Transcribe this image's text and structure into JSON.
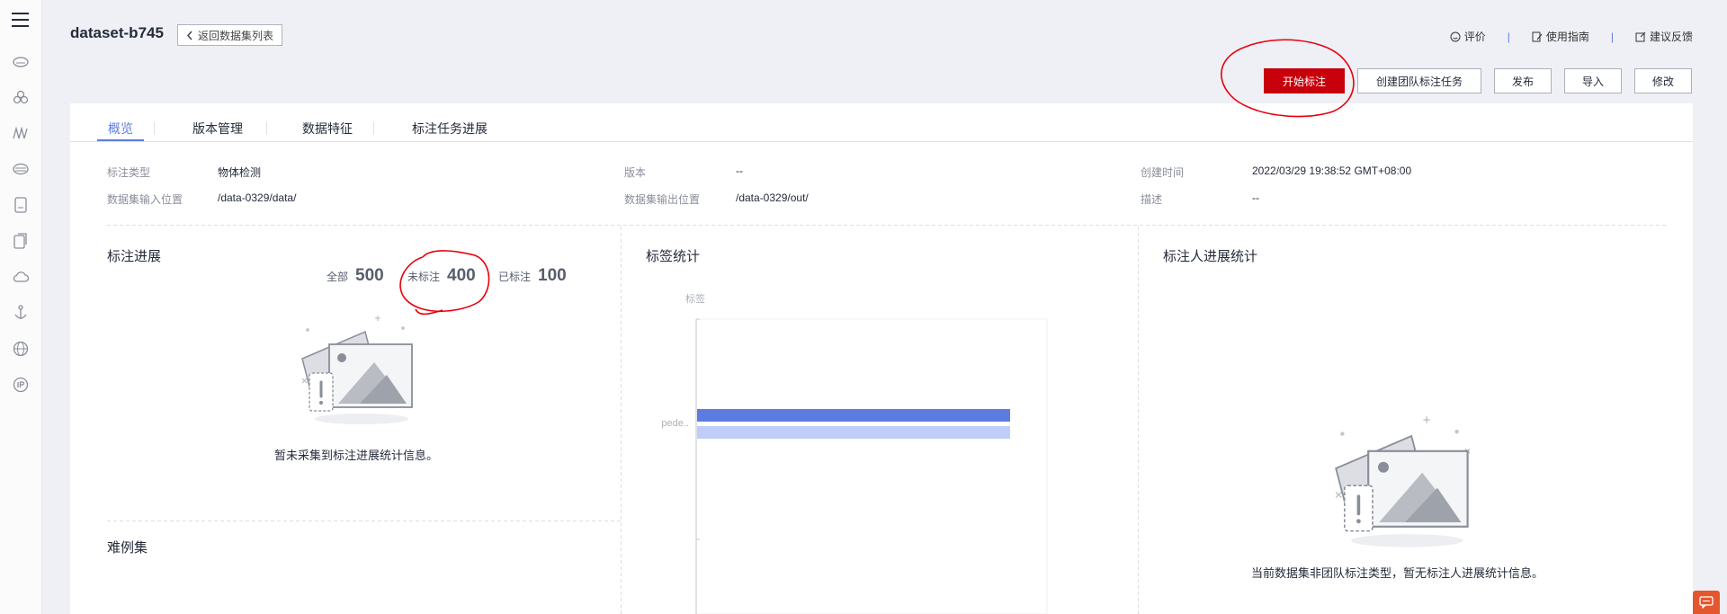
{
  "header": {
    "dataset_title": "dataset-b745",
    "back_label": "返回数据集列表",
    "links": {
      "rate": "评价",
      "guide": "使用指南",
      "feedback": "建议反馈"
    }
  },
  "actions": {
    "start_label": "开始标注",
    "team_label": "创建团队标注任务",
    "publish_label": "发布",
    "import_label": "导入",
    "edit_label": "修改"
  },
  "tabs": [
    "概览",
    "版本管理",
    "数据特征",
    "标注任务进展"
  ],
  "meta": {
    "label_type_key": "标注类型",
    "label_type_val": "物体检测",
    "input_key": "数据集输入位置",
    "input_val": "/data-0329/data/",
    "version_key": "版本",
    "version_val": "--",
    "output_key": "数据集输出位置",
    "output_val": "/data-0329/out/",
    "created_key": "创建时间",
    "created_val": "2022/03/29 19:38:52 GMT+08:00",
    "desc_key": "描述",
    "desc_val": "--"
  },
  "progress": {
    "title": "标注进展",
    "all_label": "全部",
    "all_value": "500",
    "unlabeled_label": "未标注",
    "unlabeled_value": "400",
    "labeled_label": "已标注",
    "labeled_value": "100",
    "empty_text": "暂未采集到标注进展统计信息。"
  },
  "hard_examples": {
    "title": "难例集"
  },
  "label_stats": {
    "title": "标签统计"
  },
  "chart_data": {
    "type": "bar",
    "orientation": "horizontal",
    "ylabel": "标签",
    "categories": [
      "pede.."
    ],
    "series": [
      {
        "values": [
          1.0
        ],
        "color": "#5e7ce0"
      },
      {
        "values": [
          1.0
        ],
        "color": "#bfcdf8"
      }
    ]
  },
  "annotator_stats": {
    "title": "标注人进展统计",
    "empty_text": "当前数据集非团队标注类型，暂无标注人进展统计信息。"
  },
  "colors": {
    "brand_red": "#c7000b",
    "accent_blue": "#5e7ce0",
    "annotation_red": "#e8000b"
  }
}
